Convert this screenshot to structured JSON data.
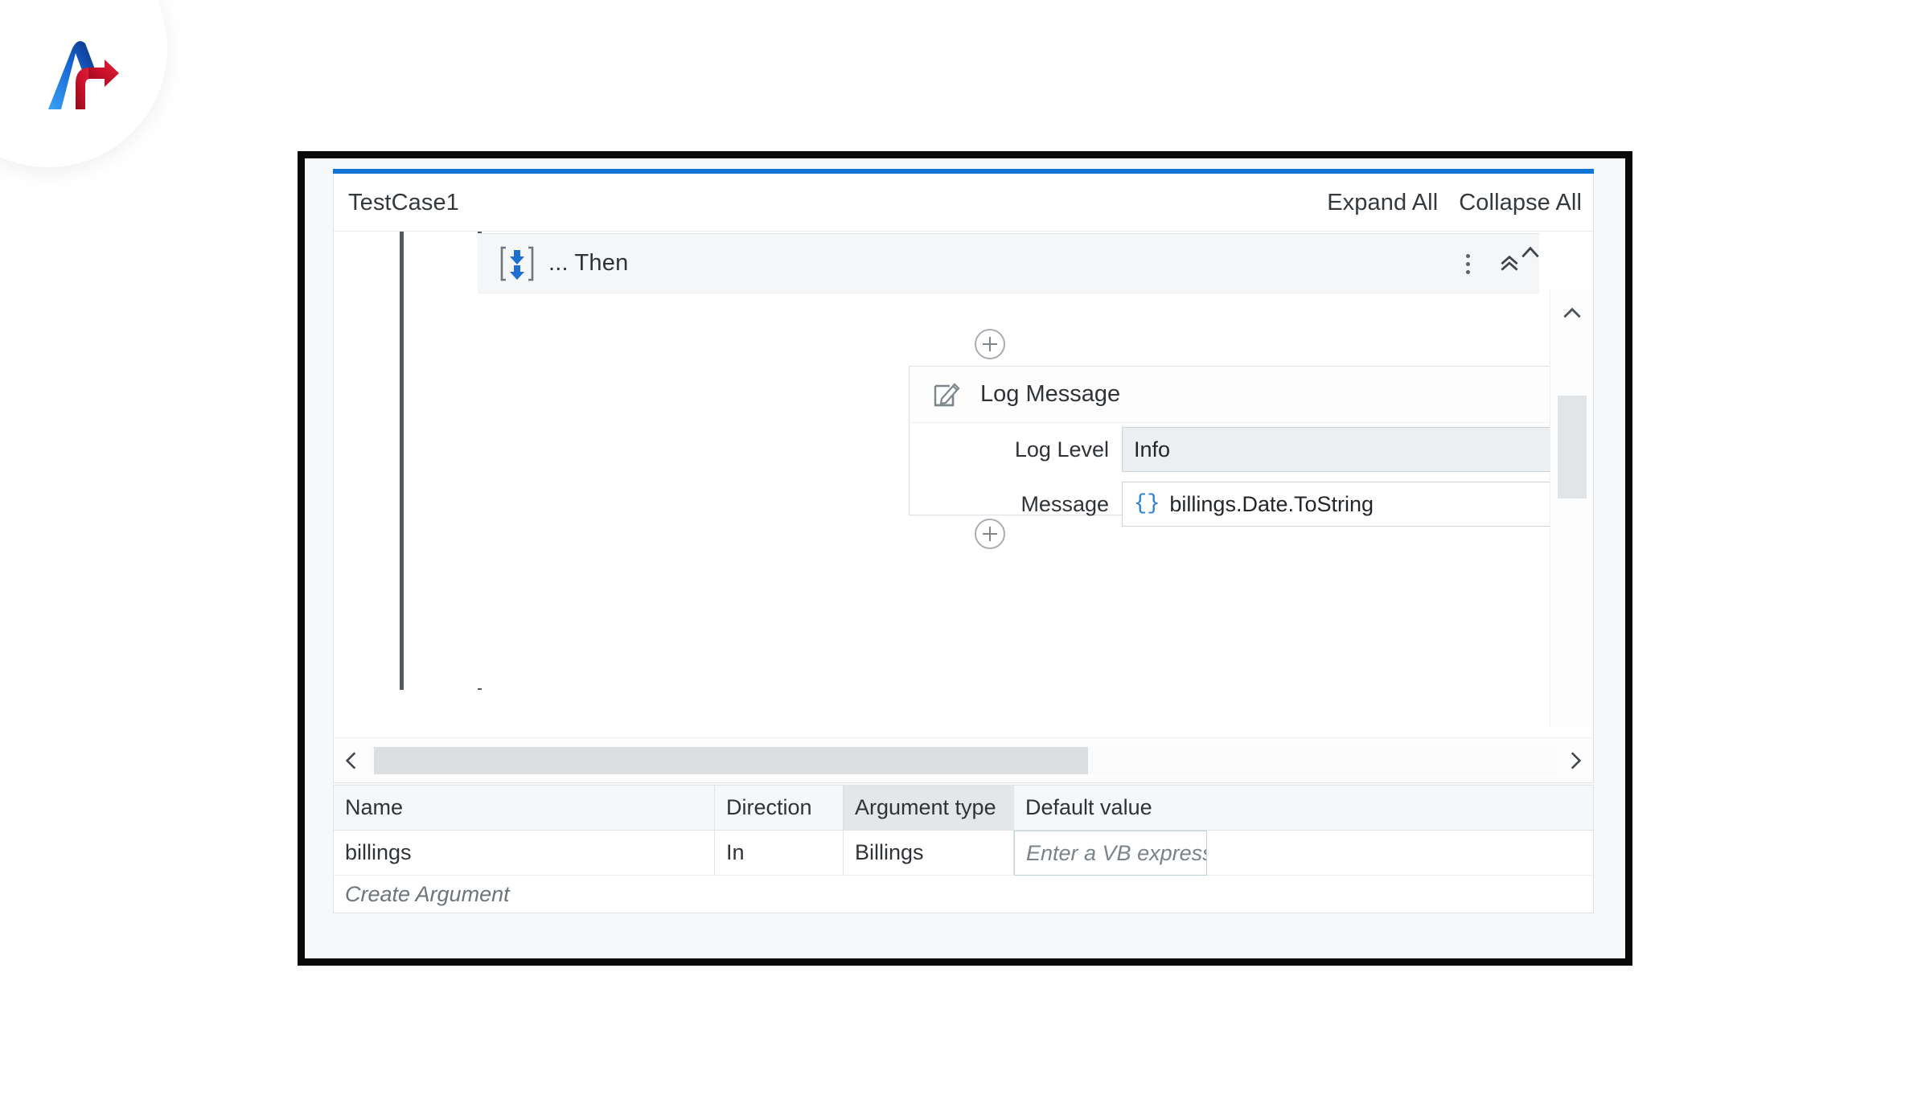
{
  "brand": {
    "logo_name": "ascendion-logo"
  },
  "designer": {
    "breadcrumb": "TestCase1",
    "expand_all_label": "Expand All",
    "collapse_all_label": "Collapse All",
    "accent_color": "#1074d4"
  },
  "sequence": {
    "icon": "if-then-branch-icon",
    "label": "... Then",
    "menu_icon": "kebab-menu-icon",
    "collapse_icon": "double-chevron-up-icon",
    "scroll_icon": "chevron-up-icon"
  },
  "connectors": {
    "top_plus": "+",
    "bottom_plus": "+"
  },
  "activity": {
    "icon": "note-pencil-icon",
    "title": "Log Message",
    "menu_icon": "kebab-menu-icon",
    "collapse_icon": "double-chevron-up-icon",
    "properties": [
      {
        "label": "Log Level",
        "type": "dropdown",
        "value": "Info",
        "chevron": "chevron-down-icon"
      },
      {
        "label": "Message",
        "type": "expression",
        "braces": "{}",
        "value": "billings.Date.ToString",
        "expand_icon": "expand-corner-icon",
        "plus_icon": "add-circle-icon"
      }
    ]
  },
  "scrollbars": {
    "vertical_up": "chevron-up-icon",
    "vertical_down": "chevron-down-icon",
    "horizontal_left": "chevron-left-icon",
    "horizontal_right": "chevron-right-icon"
  },
  "arguments": {
    "columns": [
      "Name",
      "Direction",
      "Argument type",
      "Default value"
    ],
    "rows": [
      {
        "name": "billings",
        "direction": "In",
        "argument_type": "Billings",
        "default_value_placeholder": "Enter a VB expressio"
      }
    ],
    "create_label": "Create Argument"
  }
}
